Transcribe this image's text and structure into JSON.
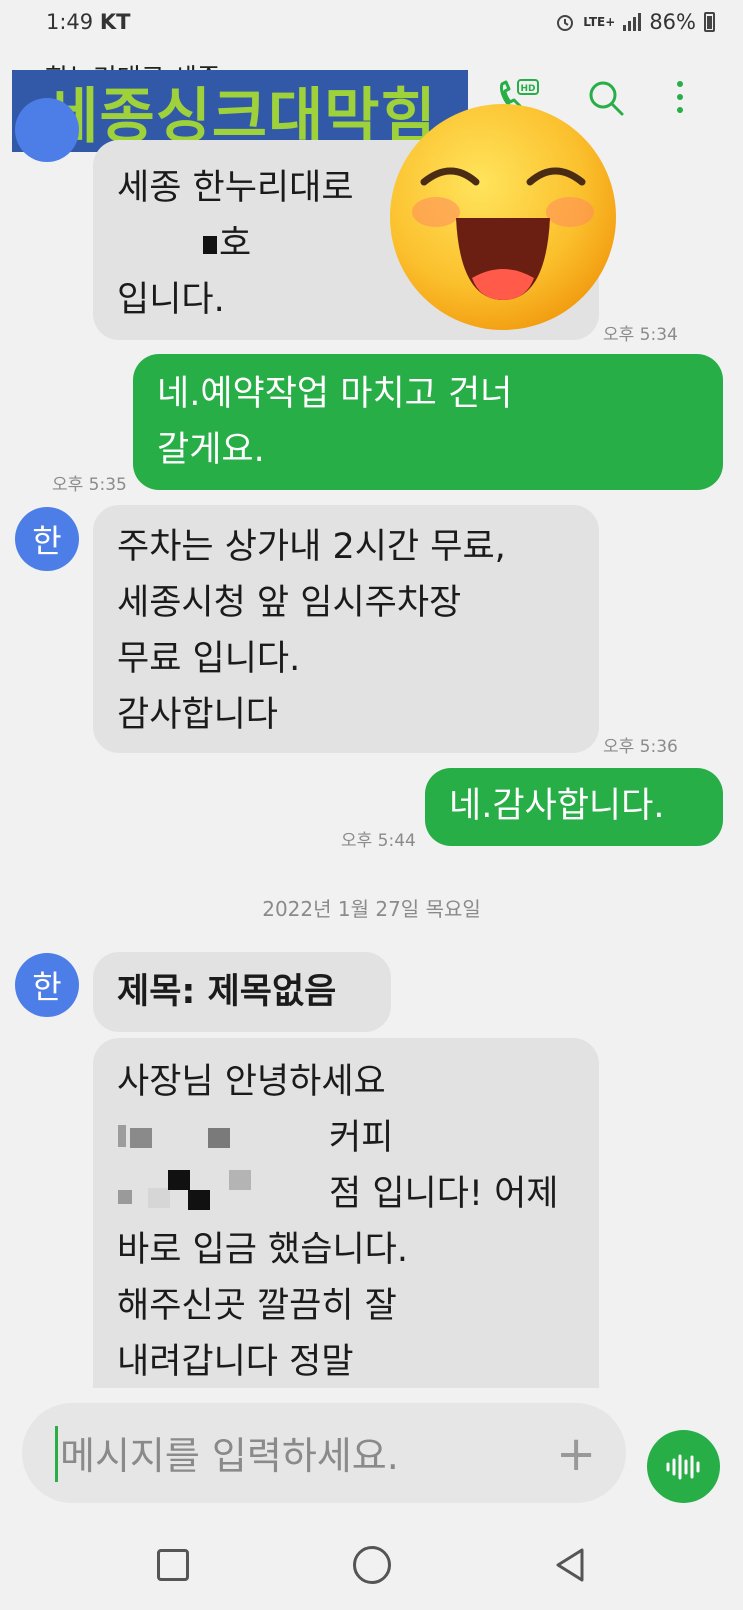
{
  "status_bar": {
    "time": "1:49",
    "carrier": "KT",
    "network": "LTE+",
    "battery": "86%"
  },
  "header": {
    "title": "한누리대로 세종"
  },
  "overlay": {
    "text": "세종싱크대막힘"
  },
  "messages": [
    {
      "side": "in",
      "lines": [
        "세종 한누리대로",
        "호",
        "입니다."
      ],
      "time": "오후 5:34"
    },
    {
      "side": "out",
      "lines": [
        "네.예약작업 마치고 건너",
        "갈게요."
      ],
      "time": "오후 5:35"
    },
    {
      "side": "in",
      "avatar": "한",
      "lines": [
        "주차는 상가내 2시간 무료,",
        "세종시청 앞 임시주차장",
        "무료 입니다.",
        "감사합니다"
      ],
      "time": "오후 5:36"
    },
    {
      "side": "out",
      "lines": [
        "네.감사합니다."
      ],
      "time": "오후 5:44"
    }
  ],
  "date_separator": "2022년 1월 27일 목요일",
  "mms": {
    "avatar": "한",
    "subject": "제목: 제목없음",
    "lines": [
      "사장님 안녕하세요",
      "커피",
      "점 입니다! 어제",
      "바로 입금 했습니다.",
      "해주신곳 깔끔히 잘",
      "내려갑니다 정말"
    ]
  },
  "composer": {
    "placeholder": "메시지를 입력하세요."
  },
  "icons": [
    "hd-call-icon",
    "search-icon",
    "more-vert-icon",
    "plus-icon",
    "voice-wave-icon",
    "recents-icon",
    "home-icon",
    "back-icon"
  ],
  "colors": {
    "accent": "#27ae47",
    "avatar": "#4d7ee8",
    "overlay_bg": "#3159a8",
    "overlay_text": "#9ed13a"
  }
}
